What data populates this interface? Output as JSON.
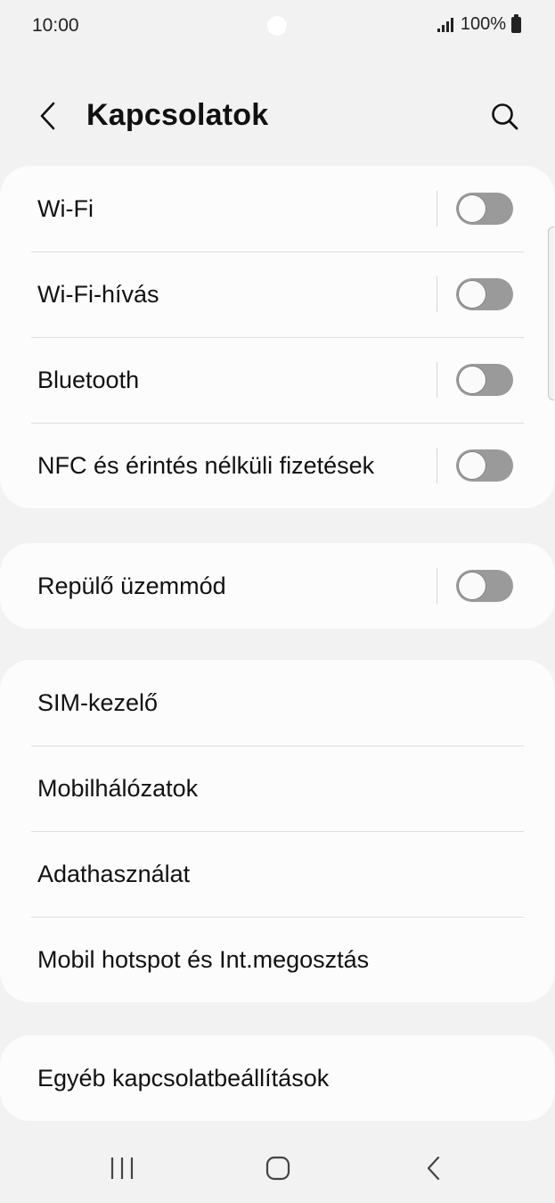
{
  "status_bar": {
    "time": "10:00",
    "battery": "100%"
  },
  "header": {
    "title": "Kapcsolatok"
  },
  "groups": [
    {
      "rows": [
        {
          "label": "Wi-Fi",
          "toggle": false
        },
        {
          "label": "Wi-Fi-hívás",
          "toggle": false
        },
        {
          "label": "Bluetooth",
          "toggle": false
        },
        {
          "label": "NFC és érintés nélküli fizetések",
          "toggle": false
        }
      ]
    },
    {
      "rows": [
        {
          "label": "Repülő üzemmód",
          "toggle": false
        }
      ]
    },
    {
      "rows": [
        {
          "label": "SIM-kezelő"
        },
        {
          "label": "Mobilhálózatok"
        },
        {
          "label": "Adathasználat"
        },
        {
          "label": "Mobil hotspot és Int.megosztás"
        }
      ]
    },
    {
      "rows": [
        {
          "label": "Egyéb kapcsolatbeállítások"
        }
      ]
    }
  ],
  "colors": {
    "background": "#f2f2f2",
    "card": "#fcfcfc",
    "toggle_off_track": "#9a9a9a",
    "text": "#111111"
  },
  "icons": {
    "back": "chevron-left-icon",
    "search": "search-icon",
    "nav_recents": "recents-icon",
    "nav_home": "home-icon",
    "nav_back": "back-icon"
  }
}
